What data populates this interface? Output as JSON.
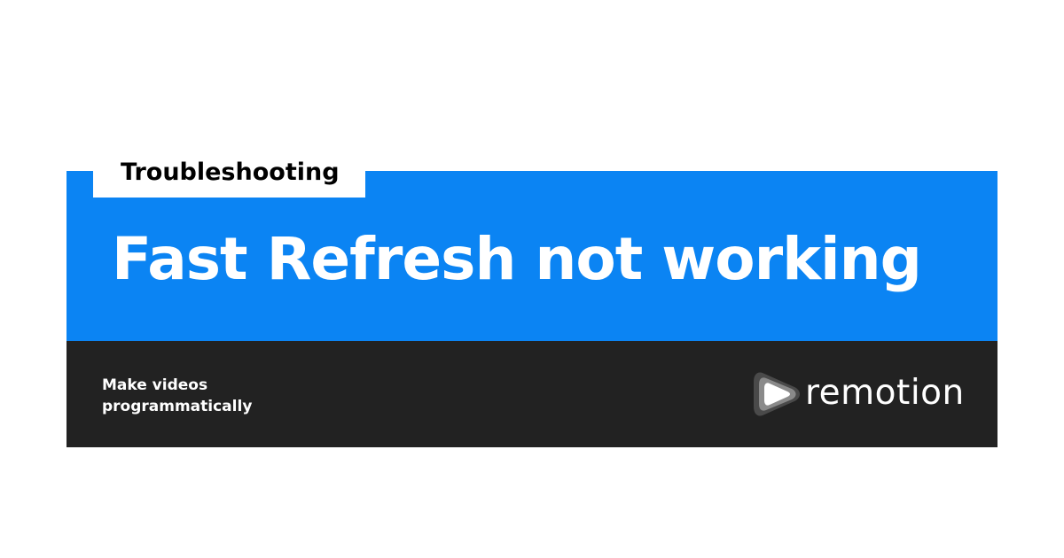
{
  "category_tag": "Troubleshooting",
  "headline": "Fast Refresh not working",
  "tagline": {
    "line1": "Make videos",
    "line2": "programmatically"
  },
  "logo": {
    "icon": "remotion-play-icon",
    "wordmark": "remotion"
  },
  "colors": {
    "accent_blue": "#0b84f3",
    "footer_dark": "#222222",
    "tag_background": "#ffffff"
  }
}
